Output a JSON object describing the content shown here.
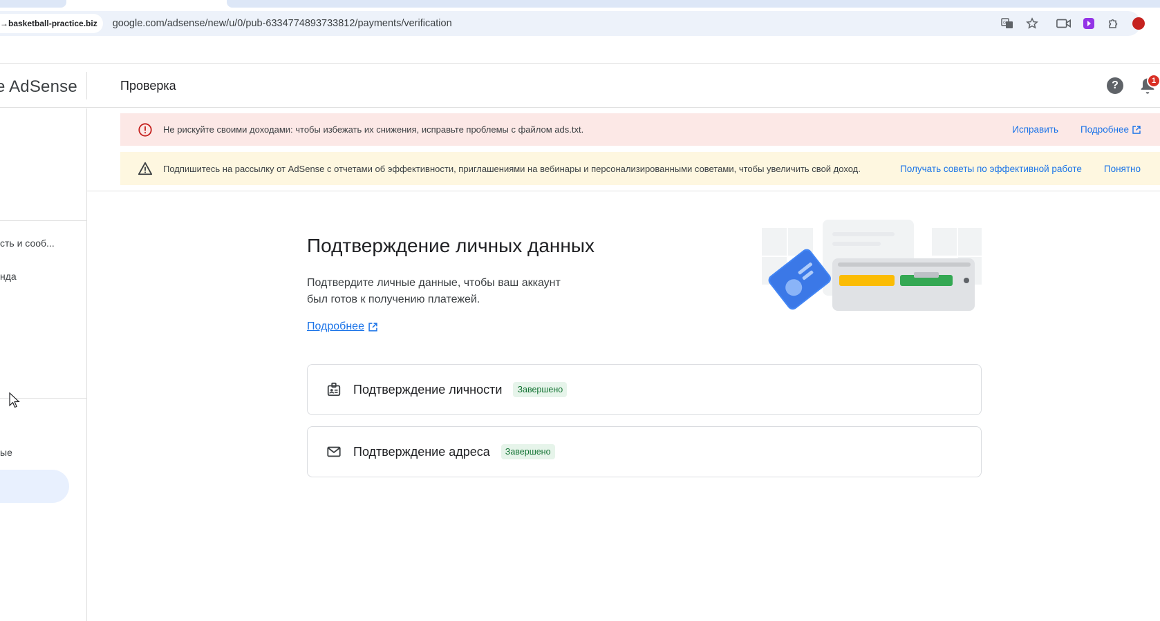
{
  "browser": {
    "site_chip": "→basketball-practice.biz",
    "url": "google.com/adsense/new/u/0/pub-6334774893733812/payments/verification",
    "icons": [
      "translate-icon",
      "star-icon",
      "camera-icon",
      "extension-purple-icon",
      "puzzle-icon",
      "profile-icon"
    ]
  },
  "header": {
    "brand": "e AdSense",
    "title": "Проверка",
    "notification_count": "1",
    "icons": [
      "help-icon",
      "bell-icon"
    ]
  },
  "sidebar": {
    "items": [
      {
        "label": "сть и сооб..."
      },
      {
        "label": "нда"
      },
      {
        "label": "ые"
      }
    ]
  },
  "banners": {
    "error": {
      "text": "Не рискуйте своими доходами: чтобы избежать их снижения, исправьте проблемы с файлом ads.txt.",
      "fix_label": "Исправить",
      "more_label": "Подробнее"
    },
    "info": {
      "text": "Подпишитесь на рассылку от AdSense с отчетами об эффективности, приглашениями на вебинары и персонализированными советами, чтобы увеличить свой доход.",
      "subscribe_label": "Получать советы по эффективной работе",
      "dismiss_label": "Понятно"
    }
  },
  "main": {
    "heading": "Подтверждение личных данных",
    "description": "Подтвердите личные данные, чтобы ваш аккаунт был готов к получению платежей.",
    "learn_more": "Подробнее",
    "cards": [
      {
        "title": "Подтверждение личности",
        "status": "Завершено",
        "icon": "id-card-icon"
      },
      {
        "title": "Подтверждение адреса",
        "status": "Завершено",
        "icon": "mail-icon"
      }
    ]
  },
  "colors": {
    "accent": "#1a73e8",
    "error_bg": "#fce8e6",
    "warning_bg": "#fef7e0",
    "success_bg": "#e6f4ea",
    "success_text": "#137333"
  }
}
